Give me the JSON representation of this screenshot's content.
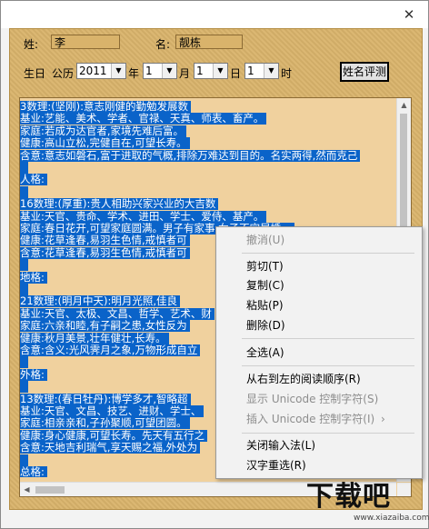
{
  "window": {
    "close_glyph": "✕"
  },
  "form": {
    "surname_label": "姓:",
    "surname_value": "李",
    "given_label": "名:",
    "given_value": "靓栋",
    "birthday_label": "生日",
    "calendar_label": "公历",
    "year_value": "2011",
    "year_unit": "年",
    "month_value": "1",
    "month_unit": "月",
    "day_value": "1",
    "day_unit": "日",
    "hour_value": "1",
    "hour_unit": "时",
    "evaluate_button": "姓名评测"
  },
  "result_lines": [
    "3数理:(坚刚):意志刚健的勤勉发展数",
    "基业:艺能、美术、学者、官禄、天真、师表、畜产。",
    "家庭:若成为达官者,家境先难后富。",
    "健康:高山立松,完健自在,可望长寿。",
    "含意:意志如磐石,富于进取的气概,排除万难达到目的。名实两得,然而克己",
    "",
    "人格:",
    "",
    "16数理:(厚重):贵人相助兴家兴业的大吉数",
    "基业:天官、贵命、学术、进田、学士、爱侍、基产。",
    "家庭:春日花开,可望家庭圆满。男子有家事,女子不宜早婚。",
    "健康:花草逢春,易羽生色情,戒慎者可",
    "含意:花草逢春,易羽生色情,戒慎者可",
    "",
    "地格:",
    "",
    "21数理:(明月中天):明月光照,佳良",
    "基业:天官、太极、文昌、哲学、艺术、财",
    "家庭:六亲和睦,有子嗣之患,女性反为",
    "健康:秋月美景,壮年健壮,长寿。",
    "含意:含义:光风霁月之象,万物形成自立",
    "",
    "外格:",
    "",
    "13数理:(春日牡丹):博学多才,智略超",
    "基业:天官、文昌、技艺、进财、学士、",
    "家庭:相亲亲和,子孙聚顺,可望团圆。",
    "健康:身心健康,可望长寿。先天有五行之",
    "含意:天地吉利瑞气,享天赐之福,外处为",
    "",
    "总格:"
  ],
  "context_menu": {
    "undo": "撤消(U)",
    "cut": "剪切(T)",
    "copy": "复制(C)",
    "paste": "粘贴(P)",
    "delete": "删除(D)",
    "select_all": "全选(A)",
    "rtl": "从右到左的阅读顺序(R)",
    "show_unicode": "显示 Unicode 控制字符(S)",
    "insert_unicode": "插入 Unicode 控制字符(I)",
    "submenu_arrow": "›",
    "close_ime": "关闭输入法(L)",
    "reconvert": "汉字重选(R)"
  },
  "watermark": {
    "main": "下载吧",
    "url": "www.xiazaiba.com"
  }
}
